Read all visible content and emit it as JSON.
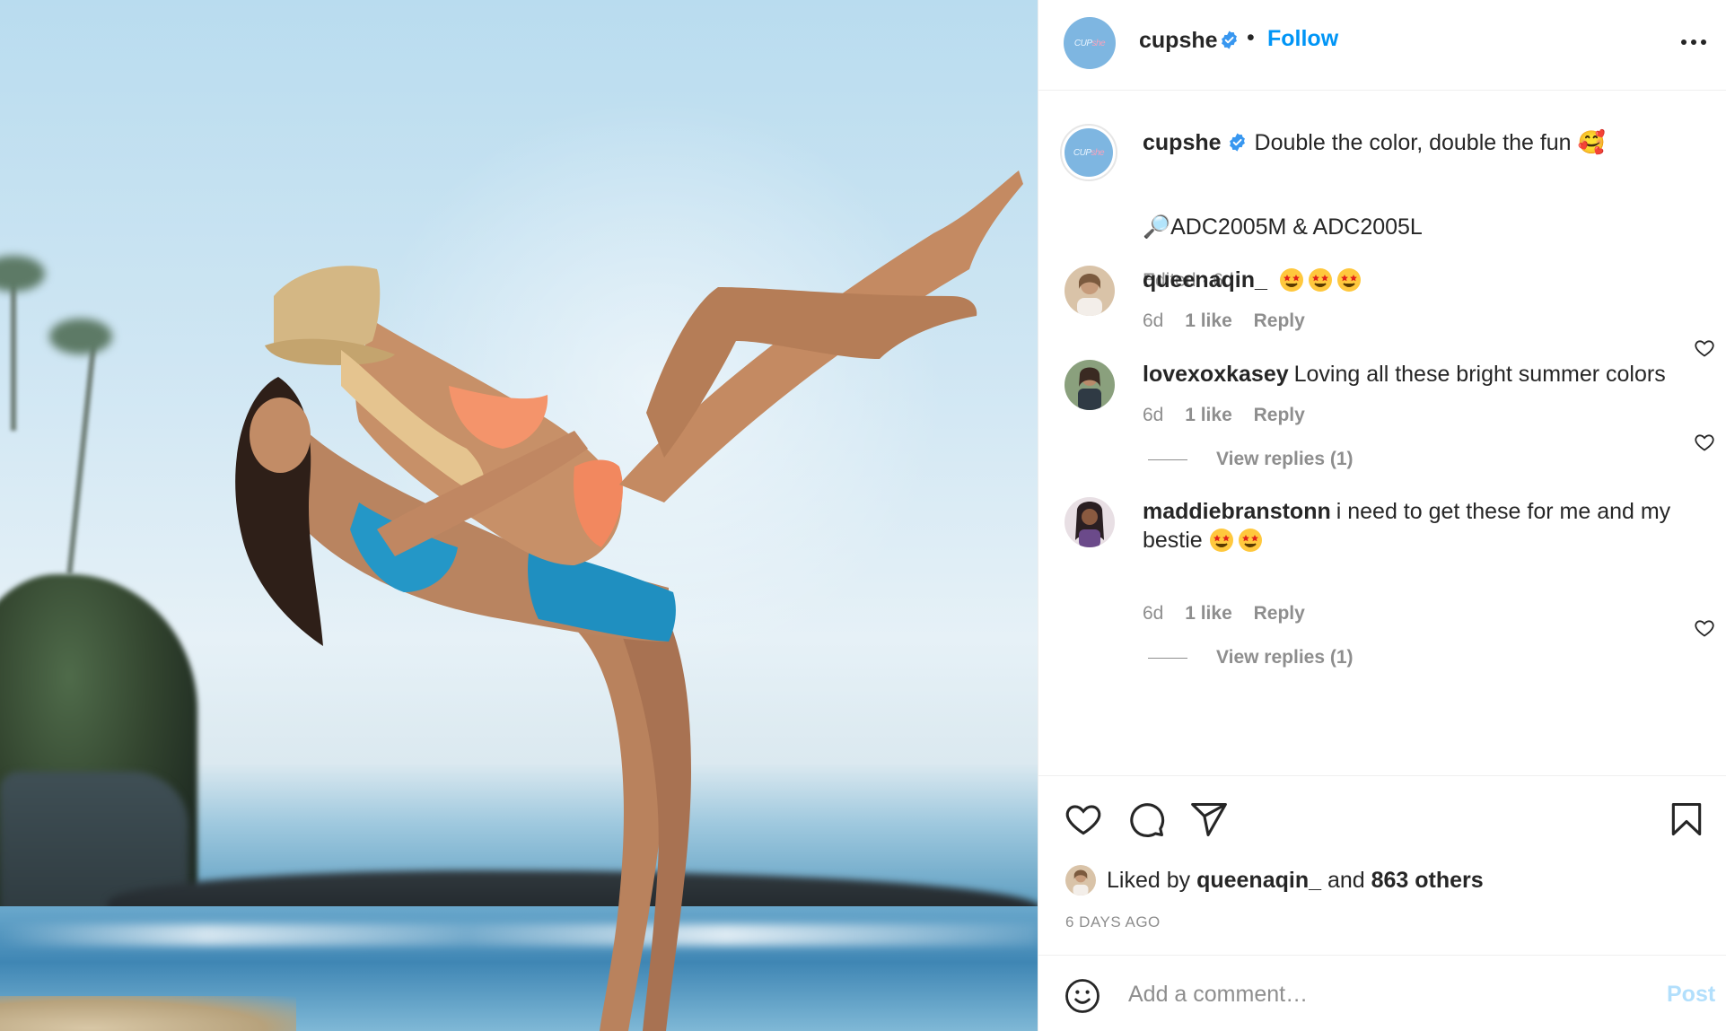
{
  "post": {
    "image_alt": "Two women in bikinis posing on a beach",
    "author": {
      "username": "cupshe",
      "verified": true,
      "avatar_text": "CUP",
      "avatar_text_accent": "she",
      "avatar_color": "#7eb6e1"
    },
    "follow_label": "Follow",
    "separator": "•"
  },
  "caption": {
    "username": "cupshe",
    "text": "Double the color, double the fun 🥰",
    "tagline": "🔎ADC2005M & ADC2005L",
    "meta": "Edited · 6d"
  },
  "comments": [
    {
      "username": "queenaqin_",
      "text": "🤩🤩🤩",
      "emoji_count": 3,
      "time": "6d",
      "likes": "1 like",
      "reply_label": "Reply",
      "avatar_colors": [
        "#d9c3a8",
        "#7b5a3e"
      ]
    },
    {
      "username": "lovexoxkasey",
      "text": "Loving all these bright summer colors",
      "time": "6d",
      "likes": "1 like",
      "reply_label": "Reply",
      "view_replies": "View replies (1)",
      "avatar_colors": [
        "#8aa07d",
        "#3a2a22"
      ]
    },
    {
      "username": "maddiebranstonn",
      "text_line1": "i need to get these for me and my",
      "text_line2": "bestie",
      "emoji_count": 2,
      "time": "6d",
      "likes": "1 like",
      "reply_label": "Reply",
      "view_replies": "View replies (1)",
      "avatar_colors": [
        "#e8dfe4",
        "#2a1f22"
      ]
    }
  ],
  "actions": {
    "icons": [
      "heart-icon",
      "comment-icon",
      "share-icon",
      "bookmark-icon"
    ]
  },
  "likes": {
    "prefix": "Liked by",
    "user": "queenaqin_",
    "conjunction": "and",
    "others": "863 others"
  },
  "timestamp": "6 DAYS AGO",
  "add_comment": {
    "placeholder": "Add a comment…",
    "post_label": "Post"
  },
  "colors": {
    "link_blue": "#0095f6",
    "post_disabled": "#b2dffc",
    "muted": "#8e8e8e",
    "text": "#262626"
  }
}
